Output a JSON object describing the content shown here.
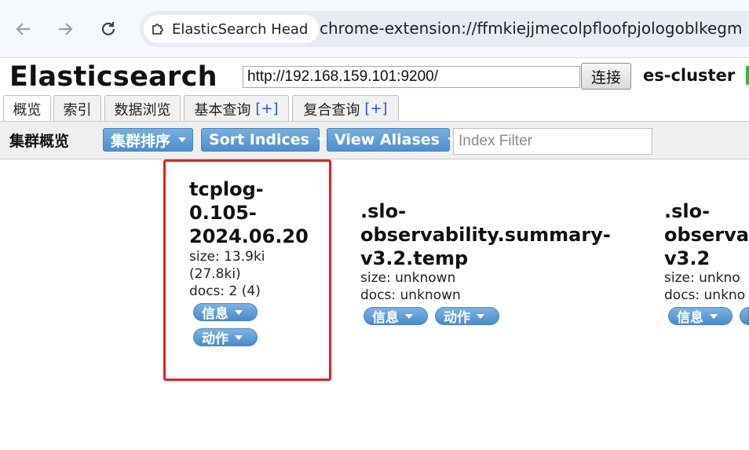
{
  "browser": {
    "tab_title": "ElasticSearch Head",
    "url": "chrome-extension://ffmkiejjmecolpfloofpjologoblkegm"
  },
  "header": {
    "app_title": "Elasticsearch",
    "es_url": "http://192.168.159.101:9200/",
    "connect_label": "连接",
    "cluster_name": "es-cluster",
    "health_color": "#22c22a"
  },
  "tabs": [
    {
      "label": "概览",
      "plus": ""
    },
    {
      "label": "索引",
      "plus": ""
    },
    {
      "label": "数据浏览",
      "plus": ""
    },
    {
      "label": "基本查询",
      "plus": "[+]"
    },
    {
      "label": "复合查询",
      "plus": "[+]"
    }
  ],
  "toolbar": {
    "title": "集群概览",
    "cluster_sort": "集群排序",
    "sort_indices": "Sort Indices",
    "view_aliases": "View Aliases",
    "index_filter_placeholder": "Index Filter"
  },
  "indices": [
    {
      "name_lines": [
        "tcplog-",
        "0.105-",
        "2024.06.20"
      ],
      "size_lines": [
        "size: 13.9ki",
        "(27.8ki)"
      ],
      "docs": "docs: 2 (4)",
      "info_label": "信息",
      "action_label": "动作"
    },
    {
      "name_lines": [
        ".slo-",
        "observability.summary-",
        "v3.2.temp"
      ],
      "size_lines": [
        "size: unknown"
      ],
      "docs": "docs: unknown",
      "info_label": "信息",
      "action_label": "动作"
    },
    {
      "name_lines": [
        ".slo-",
        "observa",
        "v3.2"
      ],
      "size_lines": [
        "size: unkno"
      ],
      "docs": "docs: unkno",
      "info_label": "信息",
      "action_label": ""
    }
  ],
  "colors": {
    "highlight_box": "#e8201e",
    "button_blue": "#5a98d2"
  }
}
